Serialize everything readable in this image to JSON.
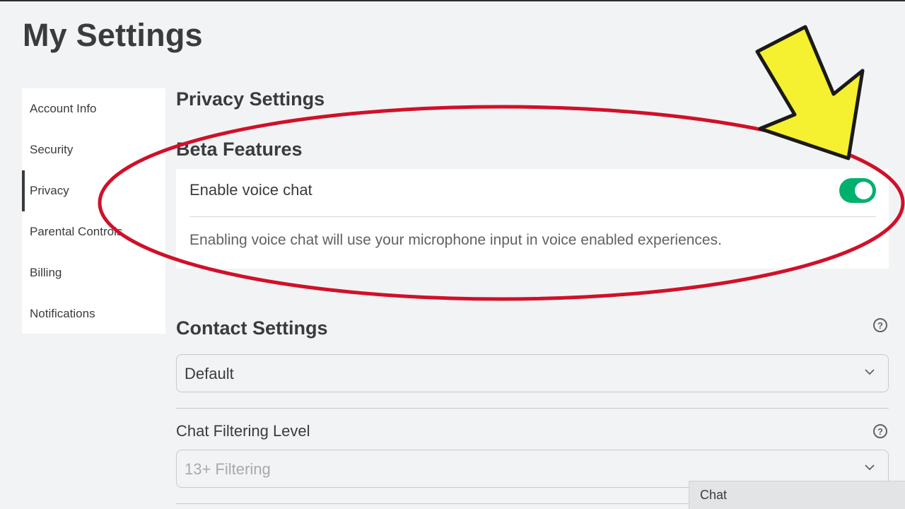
{
  "page": {
    "title": "My Settings"
  },
  "sidebar": {
    "items": [
      {
        "label": "Account Info",
        "active": false
      },
      {
        "label": "Security",
        "active": false
      },
      {
        "label": "Privacy",
        "active": true
      },
      {
        "label": "Parental Controls",
        "active": false
      },
      {
        "label": "Billing",
        "active": false
      },
      {
        "label": "Notifications",
        "active": false
      }
    ]
  },
  "privacy": {
    "heading": "Privacy Settings",
    "beta": {
      "heading": "Beta Features",
      "voice_chat_label": "Enable voice chat",
      "voice_chat_enabled": true,
      "voice_chat_description": "Enabling voice chat will use your microphone input in voice enabled experiences."
    },
    "contact": {
      "heading": "Contact Settings",
      "help_icon": "question-circle-icon",
      "selected": "Default"
    },
    "chat_filter": {
      "label": "Chat Filtering Level",
      "help_icon": "question-circle-icon",
      "selected": "13+ Filtering"
    }
  },
  "chat": {
    "label": "Chat"
  },
  "annotations": {
    "circle_color": "#d0102a",
    "arrow_color": "#f5f030",
    "arrow_icon": "arrow-pointing-down-left-icon"
  },
  "colors": {
    "toggle_on": "#00b06f",
    "background": "#f2f3f4"
  }
}
